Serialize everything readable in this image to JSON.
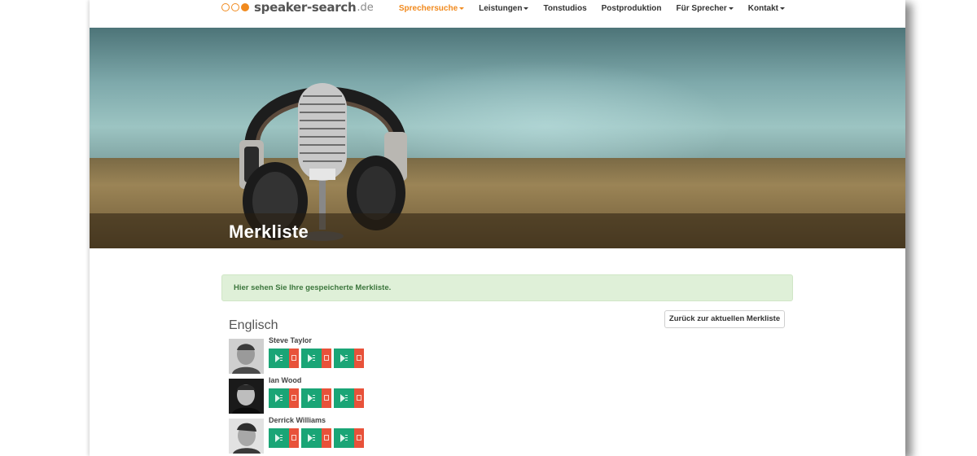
{
  "header": {
    "logo": {
      "name": "speaker-search",
      "tld": ".de"
    },
    "nav": [
      {
        "label": "Sprechersuche",
        "dropdown": true,
        "active": true
      },
      {
        "label": "Leistungen",
        "dropdown": true,
        "active": false
      },
      {
        "label": "Tonstudios",
        "dropdown": false,
        "active": false
      },
      {
        "label": "Postproduktion",
        "dropdown": false,
        "active": false
      },
      {
        "label": "Für Sprecher",
        "dropdown": true,
        "active": false
      },
      {
        "label": "Kontakt",
        "dropdown": true,
        "active": false
      }
    ]
  },
  "hero": {
    "title": "Merkliste"
  },
  "alert": {
    "text": "Hier sehen Sie Ihre gespeicherte Merkliste."
  },
  "back_button": {
    "label": "Zurück zur aktuellen Merkliste"
  },
  "section": {
    "title": "Englisch",
    "speakers": [
      {
        "name": "Steve Taylor",
        "samples": 3
      },
      {
        "name": "Ian Wood",
        "samples": 3
      },
      {
        "name": "Derrick Williams",
        "samples": 3
      }
    ]
  },
  "colors": {
    "accent": "#f18a1e",
    "play": "#1aa576",
    "download": "#e8523a",
    "alert_bg": "#dff0d8",
    "alert_text": "#3c763d"
  }
}
